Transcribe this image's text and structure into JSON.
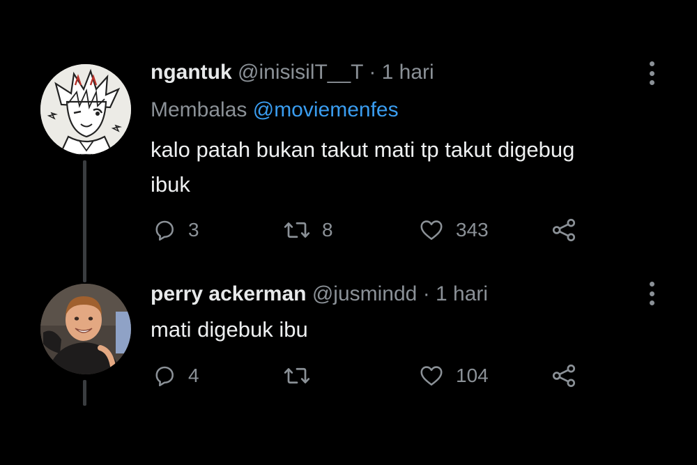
{
  "tweets": [
    {
      "name": "ngantuk",
      "handle": "@inisisilT__T",
      "separator": "·",
      "time": "1 hari",
      "reply_prefix": "Membalas",
      "reply_to": "@moviemenfes",
      "text_line1": "kalo patah bukan takut mati tp takut digebug",
      "text_line2": "ibuk",
      "replies": "3",
      "retweets": "8",
      "likes": "343",
      "avatar_icon": "anime-sketch-avatar"
    },
    {
      "name": "perry ackerman",
      "handle": "@jusmindd",
      "separator": "·",
      "time": "1 hari",
      "text_line1": "mati digebuk ibu",
      "replies": "4",
      "retweets": "",
      "likes": "104",
      "avatar_icon": "child-photo-avatar"
    }
  ],
  "colors": {
    "background": "#000000",
    "text": "#e7e9ea",
    "secondary": "#8b9197",
    "link": "#3a9df0",
    "thread_line": "#3a3d40"
  }
}
